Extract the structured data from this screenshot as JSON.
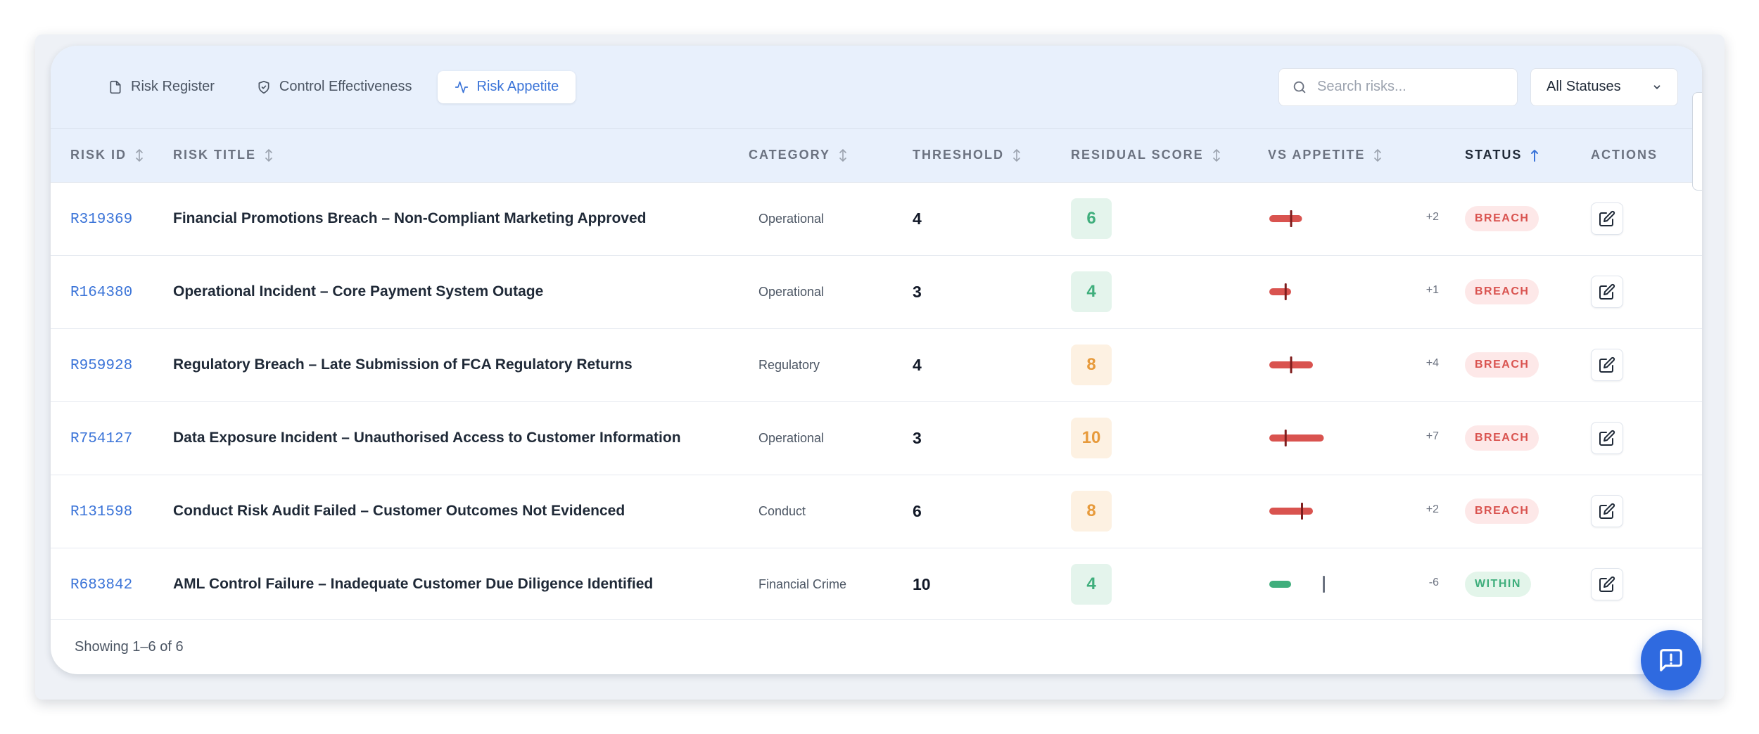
{
  "tabs": [
    {
      "label": "Risk Register",
      "icon": "document-icon",
      "active": false
    },
    {
      "label": "Control Effectiveness",
      "icon": "shield-check-icon",
      "active": false
    },
    {
      "label": "Risk Appetite",
      "icon": "activity-icon",
      "active": true
    }
  ],
  "search": {
    "placeholder": "Search risks...",
    "value": ""
  },
  "status_filter": {
    "selected": "All Statuses"
  },
  "table": {
    "columns": [
      {
        "label": "RISK ID",
        "sortable": true,
        "sorted": false
      },
      {
        "label": "RISK TITLE",
        "sortable": true,
        "sorted": false
      },
      {
        "label": "CATEGORY",
        "sortable": true,
        "sorted": false
      },
      {
        "label": "THRESHOLD",
        "sortable": true,
        "sorted": false
      },
      {
        "label": "RESIDUAL SCORE",
        "sortable": true,
        "sorted": false
      },
      {
        "label": "VS APPETITE",
        "sortable": true,
        "sorted": false
      },
      {
        "label": "STATUS",
        "sortable": true,
        "sorted": true,
        "direction": "asc"
      },
      {
        "label": "ACTIONS",
        "sortable": false,
        "sorted": false
      }
    ],
    "rows": [
      {
        "id": "R319369",
        "title": "Financial Promotions Breach – Non-Compliant Marketing Approved",
        "category": "Operational",
        "threshold": "4",
        "residual": "6",
        "delta": "+2",
        "status": "BREACH"
      },
      {
        "id": "R164380",
        "title": "Operational Incident – Core Payment System Outage",
        "category": "Operational",
        "threshold": "3",
        "residual": "4",
        "delta": "+1",
        "status": "BREACH"
      },
      {
        "id": "R959928",
        "title": "Regulatory Breach – Late Submission of FCA Regulatory Returns",
        "category": "Regulatory",
        "threshold": "4",
        "residual": "8",
        "delta": "+4",
        "status": "BREACH"
      },
      {
        "id": "R754127",
        "title": "Data Exposure Incident – Unauthorised Access to Customer Information",
        "category": "Operational",
        "threshold": "3",
        "residual": "10",
        "delta": "+7",
        "status": "BREACH"
      },
      {
        "id": "R131598",
        "title": "Conduct Risk Audit Failed – Customer Outcomes Not Evidenced",
        "category": "Conduct",
        "threshold": "6",
        "residual": "8",
        "delta": "+2",
        "status": "BREACH"
      },
      {
        "id": "R683842",
        "title": "AML Control Failure – Inadequate Customer Due Diligence Identified",
        "category": "Financial Crime",
        "threshold": "10",
        "residual": "4",
        "delta": "-6",
        "status": "WITHIN"
      }
    ]
  },
  "pagination": {
    "summary": "Showing 1–6 of 6"
  },
  "colors": {
    "accent": "#3b74d8",
    "breach": "#d9534f",
    "within": "#3fae7c",
    "score_high": "#e79a3b",
    "fab": "#2f6ae0"
  },
  "icons": {
    "search": "search-icon",
    "dropdown": "chevron-down-icon",
    "edit": "edit-icon",
    "fab": "feedback-chat-icon"
  }
}
